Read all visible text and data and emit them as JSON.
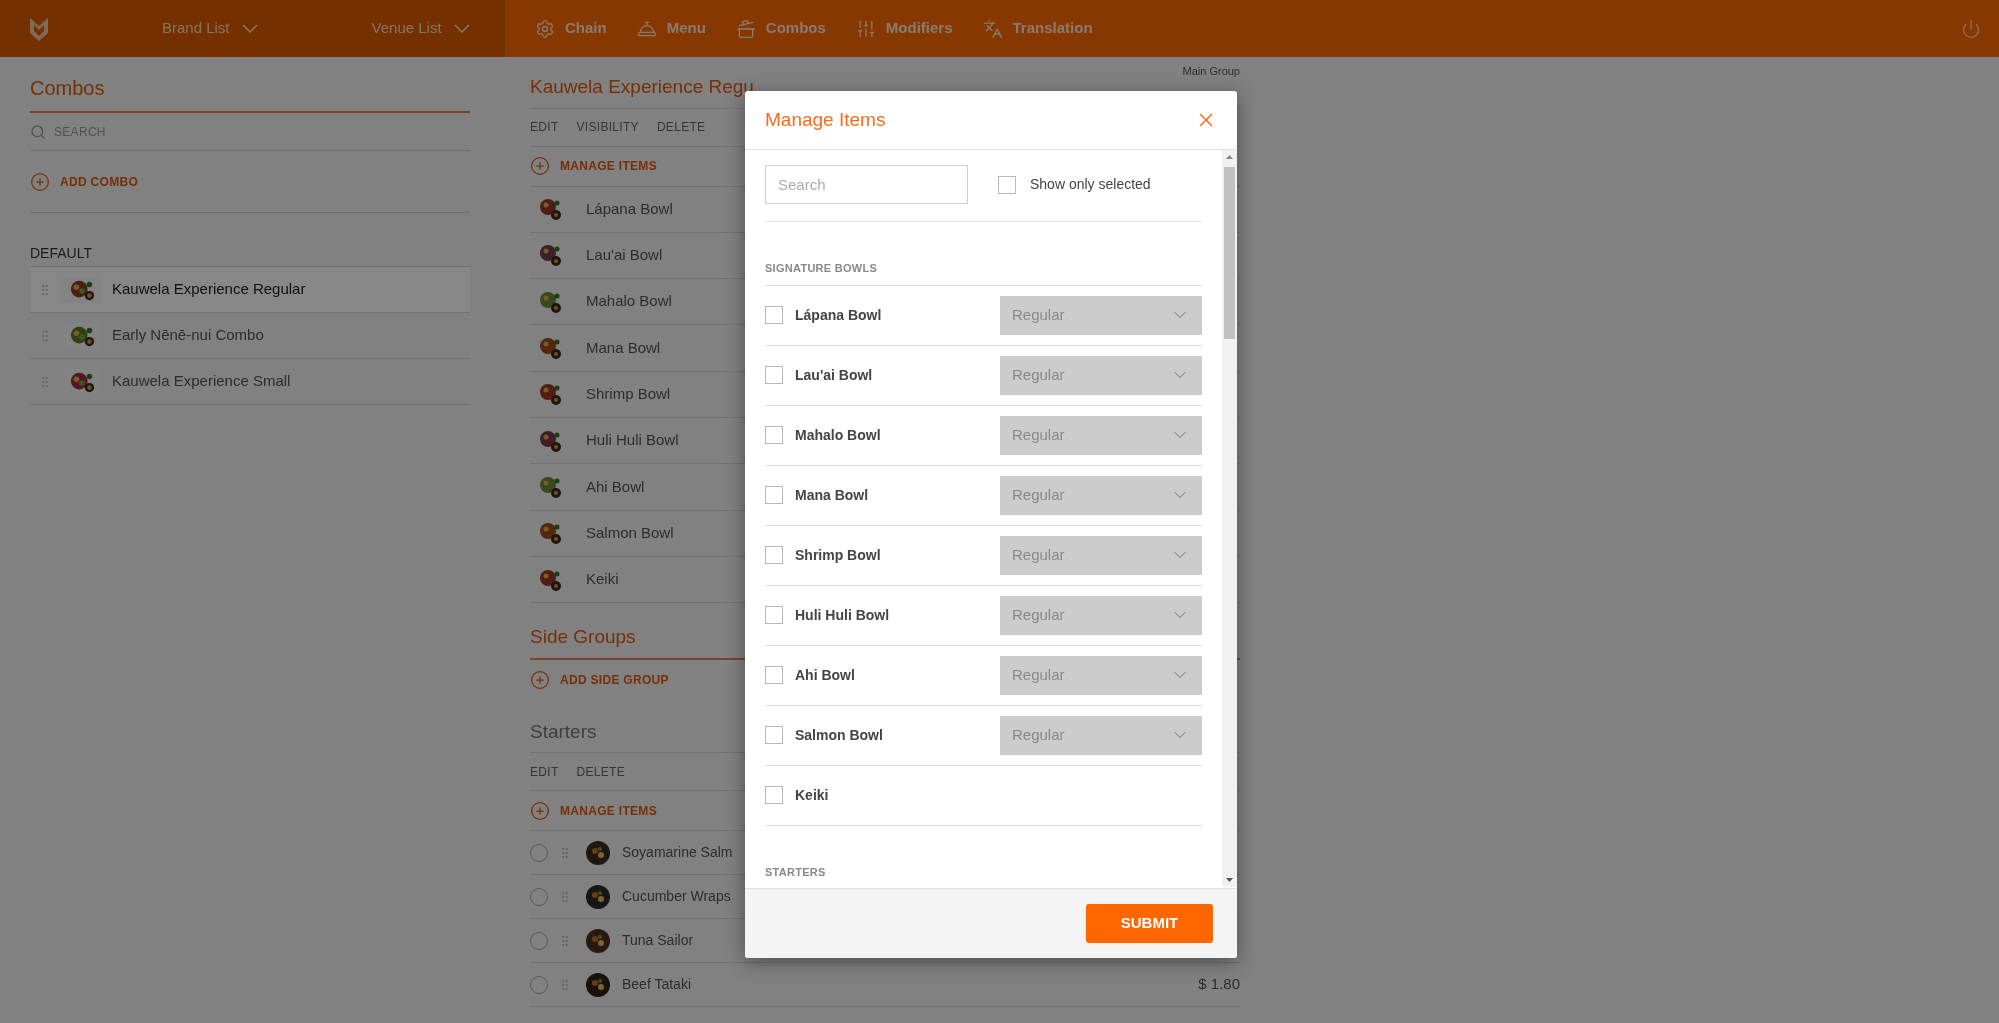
{
  "header": {
    "brand_menu": "Brand List",
    "venue_menu": "Venue List",
    "nav": [
      {
        "label": "Chain",
        "kind": "gear"
      },
      {
        "label": "Menu",
        "kind": "cloche"
      },
      {
        "label": "Combos",
        "kind": "dish"
      },
      {
        "label": "Modifiers",
        "kind": "sliders"
      },
      {
        "label": "Translation",
        "kind": "translate"
      }
    ]
  },
  "sidebar": {
    "title": "Combos",
    "search_placeholder": "SEARCH",
    "add_button": "ADD COMBO",
    "group": "DEFAULT",
    "items": [
      {
        "name": "Kauwela Experience Regular",
        "selected": true
      },
      {
        "name": "Early Nēnē-nui Combo",
        "selected": false
      },
      {
        "name": "Kauwela Experience Small",
        "selected": false
      }
    ]
  },
  "combo": {
    "title": "Kauwela Experience Regu",
    "corner_label": "Main Group",
    "actions": [
      "EDIT",
      "VISIBILITY",
      "DELETE"
    ],
    "manage_button": "MANAGE ITEMS",
    "items": [
      "Lápana Bowl",
      "Lau'ai Bowl",
      "Mahalo Bowl",
      "Mana Bowl",
      "Shrimp Bowl",
      "Huli Huli Bowl",
      "Ahi Bowl",
      "Salmon Bowl",
      "Keiki"
    ]
  },
  "side_groups": {
    "title": "Side Groups",
    "add_button": "ADD SIDE GROUP"
  },
  "starters": {
    "title": "Starters",
    "actions": [
      "EDIT",
      "DELETE"
    ],
    "manage_button": "MANAGE ITEMS",
    "items": [
      {
        "name": "Soyamarine Salm",
        "selected": false
      },
      {
        "name": "Cucumber Wraps",
        "selected": false
      },
      {
        "name": "Tuna Sailor",
        "selected": false
      },
      {
        "name": "Beef Tataki",
        "selected": false,
        "price": "$ 1.80"
      }
    ]
  },
  "modal": {
    "title": "Manage Items",
    "search_placeholder": "Search",
    "show_only_selected": {
      "label": "Show only selected",
      "checked": false
    },
    "sections": [
      {
        "title": "SIGNATURE BOWLS",
        "items": [
          {
            "name": "Lápana Bowl",
            "checked": false,
            "size": "Regular"
          },
          {
            "name": "Lau'ai Bowl",
            "checked": false,
            "size": "Regular"
          },
          {
            "name": "Mahalo Bowl",
            "checked": false,
            "size": "Regular"
          },
          {
            "name": "Mana Bowl",
            "checked": false,
            "size": "Regular"
          },
          {
            "name": "Shrimp Bowl",
            "checked": false,
            "size": "Regular"
          },
          {
            "name": "Huli Huli Bowl",
            "checked": false,
            "size": "Regular"
          },
          {
            "name": "Ahi Bowl",
            "checked": false,
            "size": "Regular"
          },
          {
            "name": "Salmon Bowl",
            "checked": false,
            "size": "Regular"
          },
          {
            "name": "Keiki",
            "checked": false
          }
        ]
      },
      {
        "title": "STARTERS"
      }
    ],
    "submit": "SUBMIT"
  }
}
